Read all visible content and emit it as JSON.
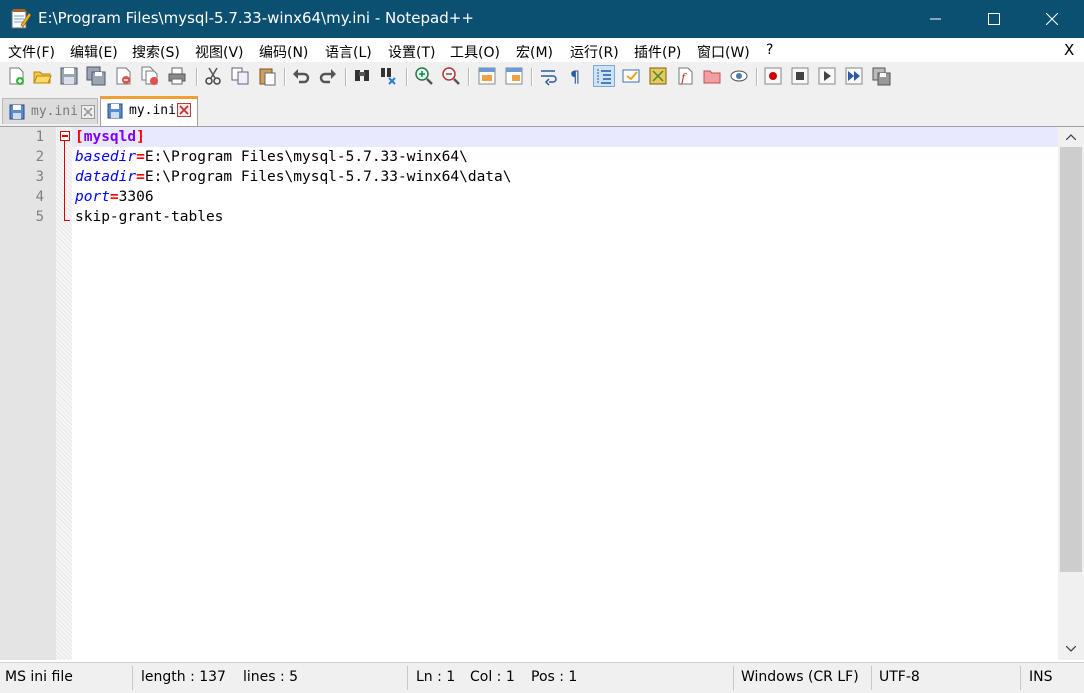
{
  "window": {
    "title": "E:\\Program Files\\mysql-5.7.33-winx64\\my.ini - Notepad++",
    "titlebar_color": "#0b4f71"
  },
  "menu": {
    "items": [
      "文件(F)",
      "编辑(E)",
      "搜索(S)",
      "视图(V)",
      "编码(N)",
      "语言(L)",
      "设置(T)",
      "工具(O)",
      "宏(M)",
      "运行(R)",
      "插件(P)",
      "窗口(W)",
      "?"
    ],
    "close_doc": "X"
  },
  "toolbar": {
    "icons": [
      "new-file-icon",
      "open-file-icon",
      "save-icon",
      "save-all-icon",
      "close-icon",
      "close-all-icon",
      "print-icon",
      "cut-icon",
      "copy-icon",
      "paste-icon",
      "undo-icon",
      "redo-icon",
      "find-icon",
      "replace-icon",
      "zoom-in-icon",
      "zoom-out-icon",
      "sync-vertical-icon",
      "sync-horizontal-icon",
      "word-wrap-icon",
      "show-all-chars-icon",
      "indent-guide-icon",
      "user-language-icon",
      "doc-map-icon",
      "function-list-icon",
      "folder-workspace-icon",
      "monitoring-icon",
      "record-macro-icon",
      "stop-macro-icon",
      "play-macro-icon",
      "run-macro-multiple-icon",
      "save-macro-icon"
    ]
  },
  "tabs": [
    {
      "label": "my.ini",
      "active": false
    },
    {
      "label": "my.ini",
      "active": true
    }
  ],
  "editor": {
    "line_numbers": [
      "1",
      "2",
      "3",
      "4",
      "5"
    ],
    "lines": [
      {
        "section": "mysqld"
      },
      {
        "key": "basedir",
        "value": "E:\\Program Files\\mysql-5.7.33-winx64\\"
      },
      {
        "key": "datadir",
        "value": "E:\\Program Files\\mysql-5.7.33-winx64\\data\\"
      },
      {
        "key": "port",
        "value": "3306"
      },
      {
        "text": "skip-grant-tables"
      }
    ],
    "colors": {
      "section": "#8000ff",
      "key": "#0000ff",
      "operator": "#ff0000",
      "current_line": "#e8e8ff"
    }
  },
  "status": {
    "file_type": "MS ini file",
    "length": "length : 137",
    "lines": "lines : 5",
    "ln": "Ln : 1",
    "col": "Col : 1",
    "pos": "Pos : 1",
    "eol": "Windows (CR LF)",
    "encoding": "UTF-8",
    "mode": "INS"
  }
}
